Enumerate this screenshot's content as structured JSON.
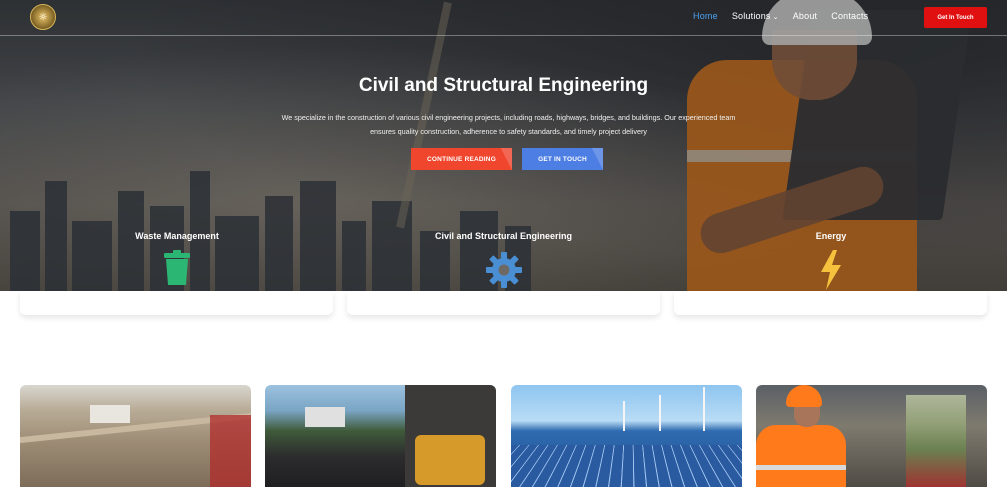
{
  "nav": {
    "logo_icon": "emblem-logo",
    "items": [
      {
        "label": "Home",
        "active": true
      },
      {
        "label": "Solutions",
        "has_dropdown": true
      },
      {
        "label": "About"
      },
      {
        "label": "Contacts"
      }
    ],
    "cta_label": "Get In Touch",
    "cta_color": "#e01010"
  },
  "hero": {
    "title": "Civil and Structural Engineering",
    "description_line1": "We specialize in the construction of various civil engineering projects, including roads, highways, bridges, and buildings. Our experienced team",
    "description_line2": "ensures quality construction, adherence to safety standards, and timely project delivery",
    "primary_button": "CONTINUE READING",
    "secondary_button": "GET IN TOUCH",
    "primary_color": "#f0462e",
    "secondary_color": "#4d7ee3",
    "accent_color": "#4aa3f0"
  },
  "services": [
    {
      "title": "Waste Management",
      "icon": "trash-bin-icon",
      "icon_color": "#2bb673"
    },
    {
      "title": "Civil and Structural Engineering",
      "icon": "gear-icon",
      "icon_color": "#4a8fd4"
    },
    {
      "title": "Energy",
      "icon": "lightning-bolt-icon",
      "icon_color": "#f6c23e"
    }
  ],
  "projects": [
    {
      "image": "construction-site-photo"
    },
    {
      "image": "road-paving-photo"
    },
    {
      "image": "solar-wind-farm-photo"
    },
    {
      "image": "recycling-worker-photo"
    }
  ]
}
